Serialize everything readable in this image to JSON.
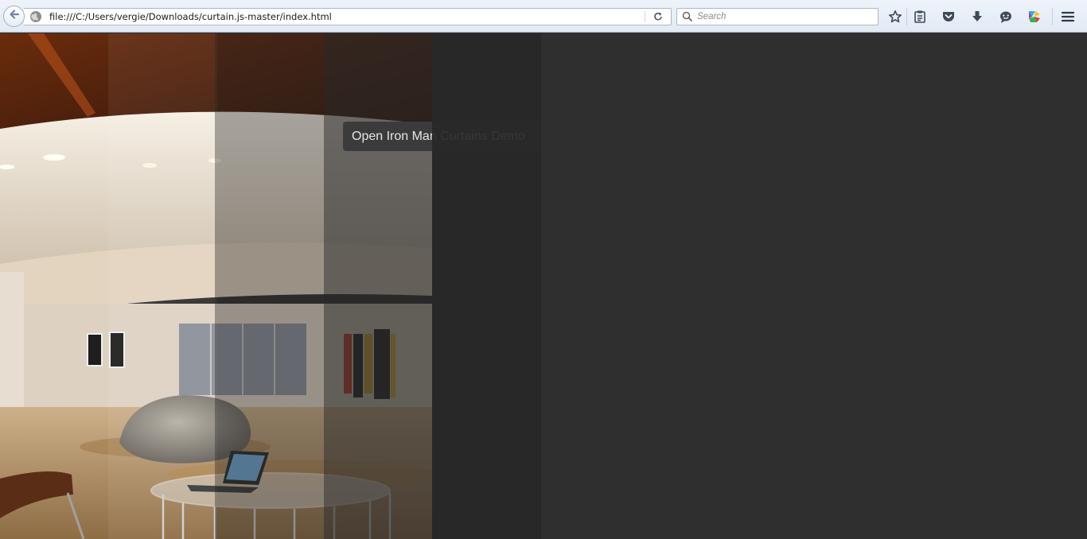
{
  "browser": {
    "url": "file:///C:/Users/vergie/Downloads/curtain.js-master/index.html",
    "search_placeholder": "Search",
    "toolbar_icons": [
      "star-icon",
      "reading-list-icon",
      "pocket-icon",
      "download-icon",
      "chat-icon",
      "extension-icon",
      "menu-icon"
    ]
  },
  "page": {
    "open_button_label": "Open Iron Man Curtains Demo",
    "scene_image": "luxury interior lobby with glass table, laptop, stone sculpture and paintings",
    "curtain_count": 4
  }
}
